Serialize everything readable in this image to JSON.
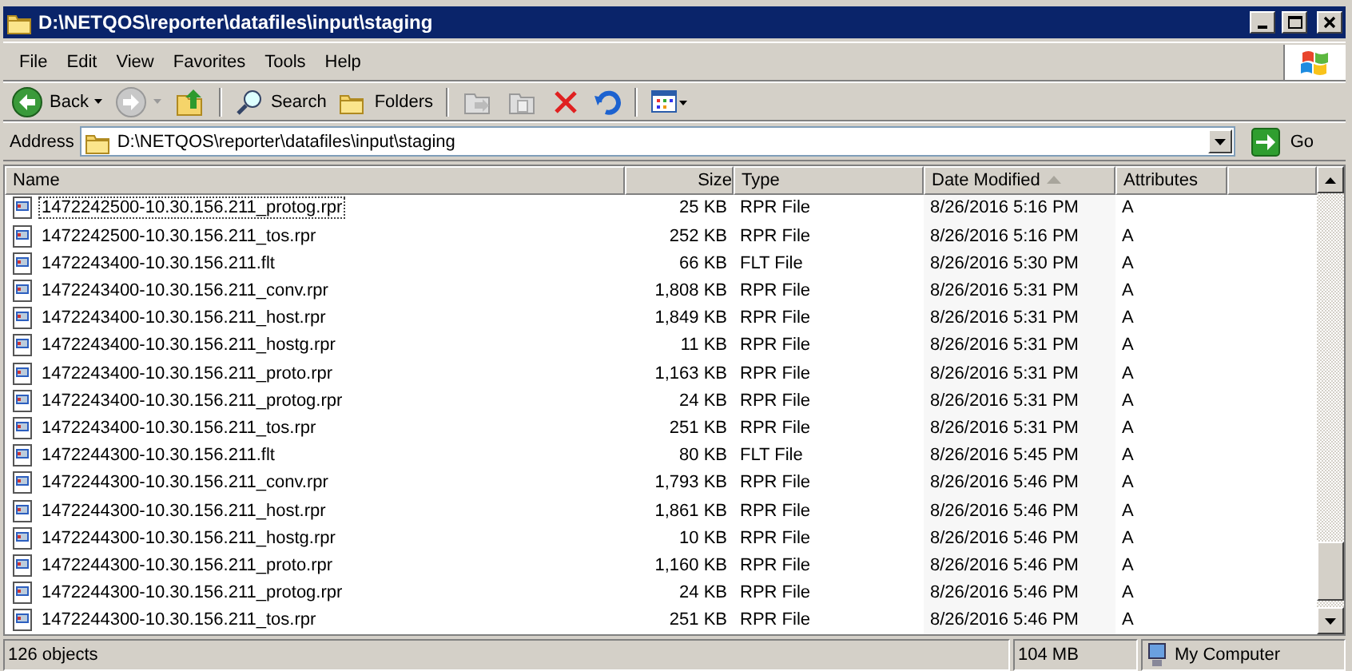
{
  "window": {
    "title": "D:\\NETQOS\\reporter\\datafiles\\input\\staging"
  },
  "menu": [
    "File",
    "Edit",
    "View",
    "Favorites",
    "Tools",
    "Help"
  ],
  "toolbar": [
    {
      "kind": "back",
      "label": "Back",
      "disabled": false
    },
    {
      "kind": "forward",
      "disabled": true
    },
    {
      "kind": "up",
      "disabled": false
    },
    {
      "kind": "search",
      "label": "Search",
      "disabled": false
    },
    {
      "kind": "folders",
      "label": "Folders",
      "disabled": false
    },
    {
      "kind": "move",
      "disabled": true
    },
    {
      "kind": "copy",
      "disabled": true
    },
    {
      "kind": "delete",
      "disabled": false
    },
    {
      "kind": "undo",
      "disabled": false
    },
    {
      "kind": "views",
      "disabled": false
    }
  ],
  "address": {
    "label": "Address",
    "value": "D:\\NETQOS\\reporter\\datafiles\\input\\staging",
    "go": "Go"
  },
  "table": {
    "columns": [
      {
        "label": "Name",
        "sorted": false
      },
      {
        "label": "Size",
        "sorted": false
      },
      {
        "label": "Type",
        "sorted": false
      },
      {
        "label": "Date Modified",
        "sorted": true
      },
      {
        "label": "Attributes",
        "sorted": false
      }
    ],
    "rows": [
      {
        "name": "1472242500-10.30.156.211_protog.rpr",
        "size": "25 KB",
        "type": "RPR File",
        "date": "8/26/2016 5:16 PM",
        "attr": "A",
        "focused": true
      },
      {
        "name": "1472242500-10.30.156.211_tos.rpr",
        "size": "252 KB",
        "type": "RPR File",
        "date": "8/26/2016 5:16 PM",
        "attr": "A",
        "focused": false
      },
      {
        "name": "1472243400-10.30.156.211.flt",
        "size": "66 KB",
        "type": "FLT File",
        "date": "8/26/2016 5:30 PM",
        "attr": "A",
        "focused": false
      },
      {
        "name": "1472243400-10.30.156.211_conv.rpr",
        "size": "1,808 KB",
        "type": "RPR File",
        "date": "8/26/2016 5:31 PM",
        "attr": "A",
        "focused": false
      },
      {
        "name": "1472243400-10.30.156.211_host.rpr",
        "size": "1,849 KB",
        "type": "RPR File",
        "date": "8/26/2016 5:31 PM",
        "attr": "A",
        "focused": false
      },
      {
        "name": "1472243400-10.30.156.211_hostg.rpr",
        "size": "11 KB",
        "type": "RPR File",
        "date": "8/26/2016 5:31 PM",
        "attr": "A",
        "focused": false
      },
      {
        "name": "1472243400-10.30.156.211_proto.rpr",
        "size": "1,163 KB",
        "type": "RPR File",
        "date": "8/26/2016 5:31 PM",
        "attr": "A",
        "focused": false
      },
      {
        "name": "1472243400-10.30.156.211_protog.rpr",
        "size": "24 KB",
        "type": "RPR File",
        "date": "8/26/2016 5:31 PM",
        "attr": "A",
        "focused": false
      },
      {
        "name": "1472243400-10.30.156.211_tos.rpr",
        "size": "251 KB",
        "type": "RPR File",
        "date": "8/26/2016 5:31 PM",
        "attr": "A",
        "focused": false
      },
      {
        "name": "1472244300-10.30.156.211.flt",
        "size": "80 KB",
        "type": "FLT File",
        "date": "8/26/2016 5:45 PM",
        "attr": "A",
        "focused": false
      },
      {
        "name": "1472244300-10.30.156.211_conv.rpr",
        "size": "1,793 KB",
        "type": "RPR File",
        "date": "8/26/2016 5:46 PM",
        "attr": "A",
        "focused": false
      },
      {
        "name": "1472244300-10.30.156.211_host.rpr",
        "size": "1,861 KB",
        "type": "RPR File",
        "date": "8/26/2016 5:46 PM",
        "attr": "A",
        "focused": false
      },
      {
        "name": "1472244300-10.30.156.211_hostg.rpr",
        "size": "10 KB",
        "type": "RPR File",
        "date": "8/26/2016 5:46 PM",
        "attr": "A",
        "focused": false
      },
      {
        "name": "1472244300-10.30.156.211_proto.rpr",
        "size": "1,160 KB",
        "type": "RPR File",
        "date": "8/26/2016 5:46 PM",
        "attr": "A",
        "focused": false
      },
      {
        "name": "1472244300-10.30.156.211_protog.rpr",
        "size": "24 KB",
        "type": "RPR File",
        "date": "8/26/2016 5:46 PM",
        "attr": "A",
        "focused": false
      },
      {
        "name": "1472244300-10.30.156.211_tos.rpr",
        "size": "251 KB",
        "type": "RPR File",
        "date": "8/26/2016 5:46 PM",
        "attr": "A",
        "focused": false
      }
    ]
  },
  "status_bar": {
    "objects": "126 objects",
    "size": "104 MB",
    "zone": "My Computer"
  }
}
